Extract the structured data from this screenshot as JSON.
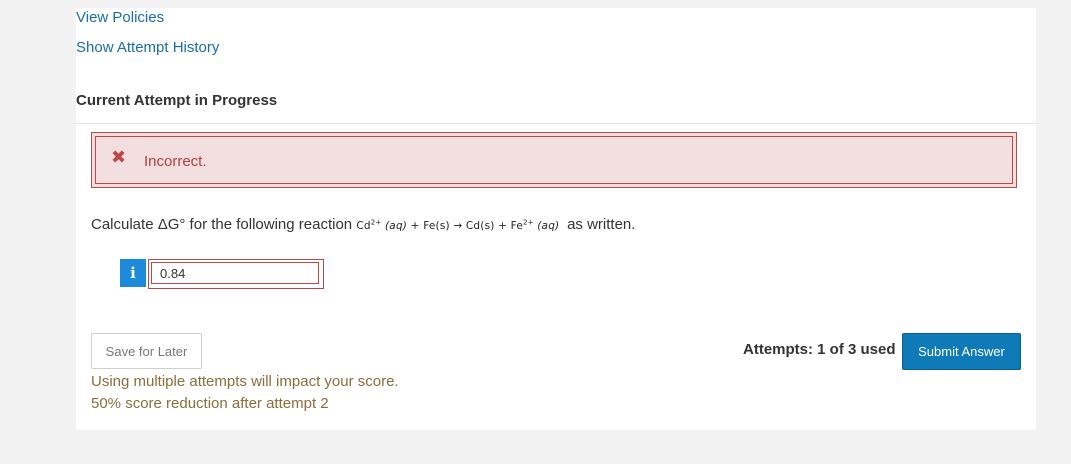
{
  "links": {
    "view_policies": "View Policies",
    "show_attempt_history": "Show Attempt History"
  },
  "section_title": "Current Attempt in Progress",
  "feedback": {
    "icon": "x-icon",
    "text": "Incorrect."
  },
  "question": {
    "prefix": "Calculate ΔG° for the following reaction",
    "reaction": {
      "cd_reactant": "Cd",
      "cd_charge": "2+",
      "aq1": "(aq)",
      "plus1": "+",
      "fe_reactant": "Fe(s)",
      "arrow": "→",
      "cd_product": "Cd(s)",
      "plus2": "+",
      "fe_product": "Fe",
      "fe_charge": "2+",
      "aq2": "(aq)"
    },
    "suffix": "as written."
  },
  "answer": {
    "info_icon": "i",
    "value": "0.84"
  },
  "buttons": {
    "save_for_later": "Save for Later",
    "submit_answer": "Submit Answer"
  },
  "attempts_text": "Attempts: 1 of 3 used",
  "warnings": {
    "line1": "Using multiple attempts will impact your score.",
    "line2": "50% score reduction after attempt 2"
  },
  "colors": {
    "link": "#1a6ea8",
    "error": "#b94a48",
    "error_bg": "#f2dede",
    "submit": "#0e7bb8",
    "info_badge": "#1c8ad8",
    "warning_text": "#8a6d3b"
  }
}
